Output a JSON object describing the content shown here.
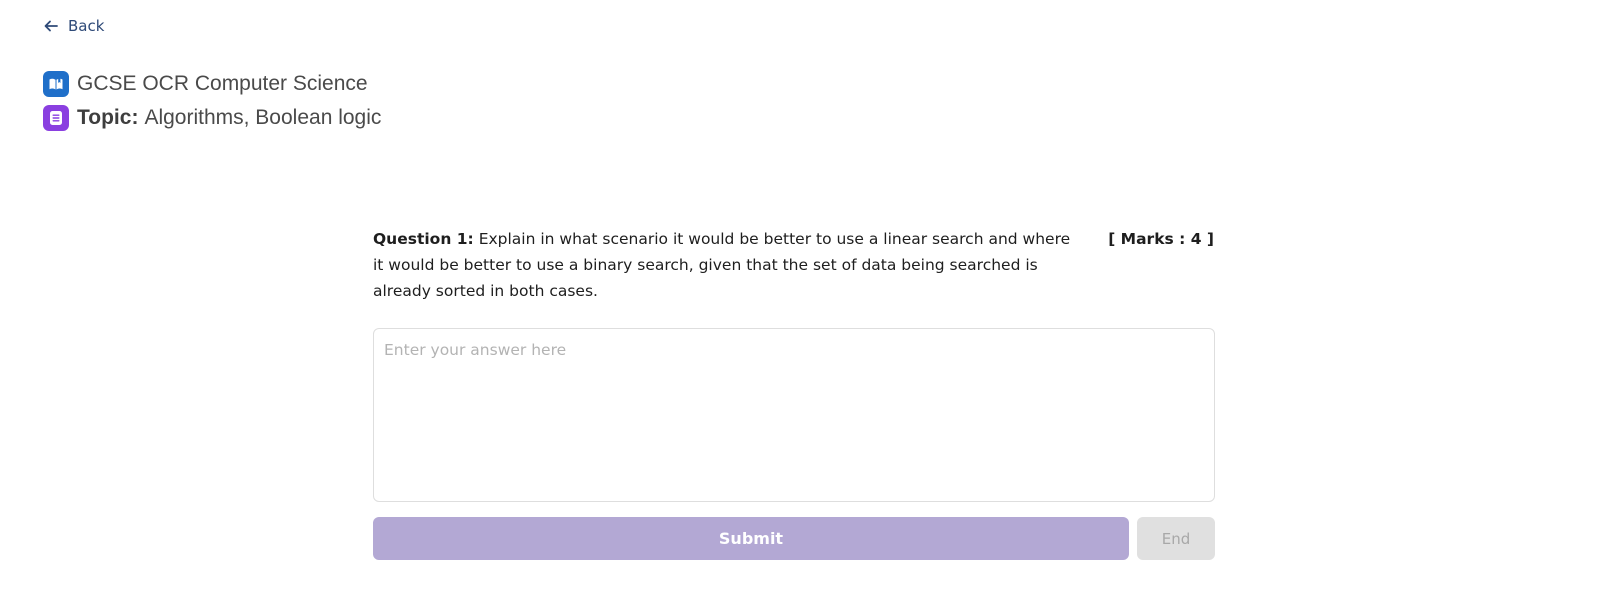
{
  "nav": {
    "back_label": "Back",
    "back_icon": "arrow-left-icon"
  },
  "header": {
    "subject": "GCSE OCR Computer Science",
    "subject_icon": "book-icon",
    "topic_label": "Topic:",
    "topic_value": "Algorithms, Boolean logic",
    "topic_icon": "document-icon",
    "subject_icon_color": "#1f6fc9",
    "topic_icon_color": "#8a3fe0"
  },
  "question": {
    "label": "Question 1:",
    "text": "Explain in what scenario it would be better to use a linear search and where it would be better to use a binary search, given that the set of data being searched is already sorted in both cases.",
    "marks": "[ Marks : 4 ]"
  },
  "answer": {
    "placeholder": "Enter your answer here",
    "value": ""
  },
  "actions": {
    "submit_label": "Submit",
    "end_label": "End",
    "submit_color": "#b3a8d4",
    "end_color": "#e0e0e0"
  }
}
